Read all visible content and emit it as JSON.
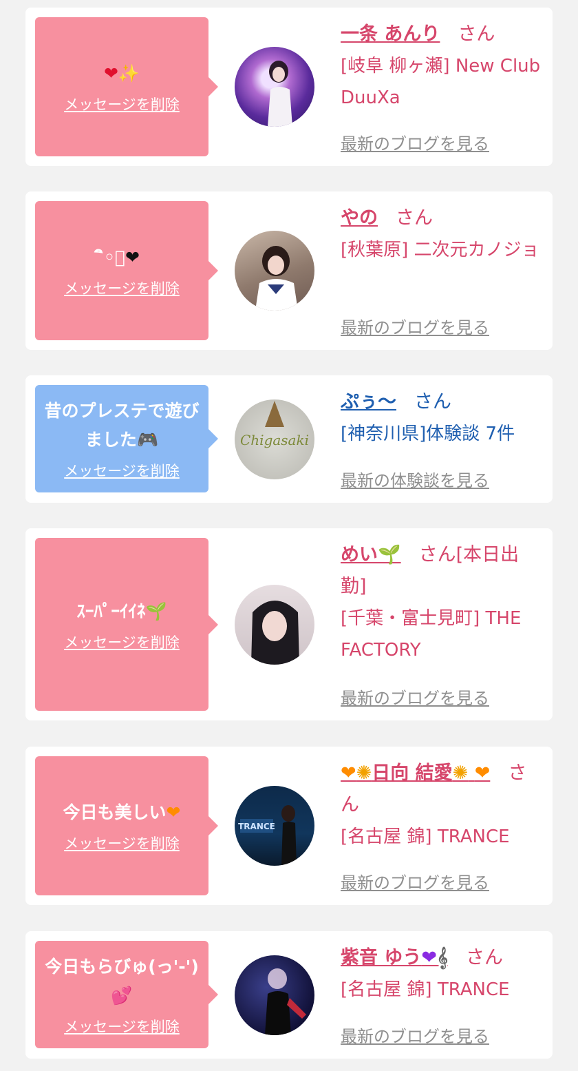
{
  "delete_label": "メッセージを削除",
  "san_label": "さん",
  "cards": [
    {
      "message": "",
      "name": "一条 あんり",
      "shop": "[岐阜 柳ヶ瀬] New Club DuuXa",
      "latest": "最新のブログを見る",
      "avatar": "photo-girl-pink-lights"
    },
    {
      "message": "ิ◦ิ",
      "name": "やの",
      "shop": "[秋葉原] 二次元カノジョ",
      "latest": "最新のブログを見る",
      "avatar": "photo-girl-sailor"
    },
    {
      "message": "昔のプレステで遊びました",
      "name": "ぷぅ〜",
      "shop": "[神奈川県]体験談 7件",
      "latest": "最新の体験談を見る",
      "avatar": "photo-chigasaki-shirt",
      "avatar_text": "Chigasaki"
    },
    {
      "message": "ｽｰﾊﾟｰｲｲﾈ",
      "name": "めい",
      "san_suffix": "[本日出勤]",
      "shop": "[千葉・富士見町] THE FACTORY",
      "latest": "最新のブログを見る",
      "avatar": "photo-girl-portrait"
    },
    {
      "message": "今日も美しい",
      "name": "日向 結愛",
      "shop": "[名古屋 錦] TRANCE",
      "latest": "最新のブログを見る",
      "avatar": "photo-girl-trance",
      "avatar_text": "TRANCE"
    },
    {
      "message": "今日もらびゅ(っ'-')",
      "name": "紫音 ゆう",
      "shop": "[名古屋 錦] TRANCE",
      "latest": "最新のブログを見る",
      "avatar": "photo-girl-stage"
    }
  ],
  "colors": {
    "pink_bubble": "#f7909f",
    "blue_bubble": "#8bb9f4",
    "pink_text": "#d6466b",
    "blue_text": "#1f5fb0",
    "link_gray": "#8f8f8f",
    "background": "#f2f2f2"
  },
  "icons": [
    "red-heart-icon",
    "sparkle-icon",
    "black-heart-icon",
    "gamepad-icon",
    "sprout-icon",
    "orange-heart-icon",
    "sunflower-icon",
    "purple-heart-icon",
    "treble-clef-icon",
    "two-hearts-icon"
  ]
}
